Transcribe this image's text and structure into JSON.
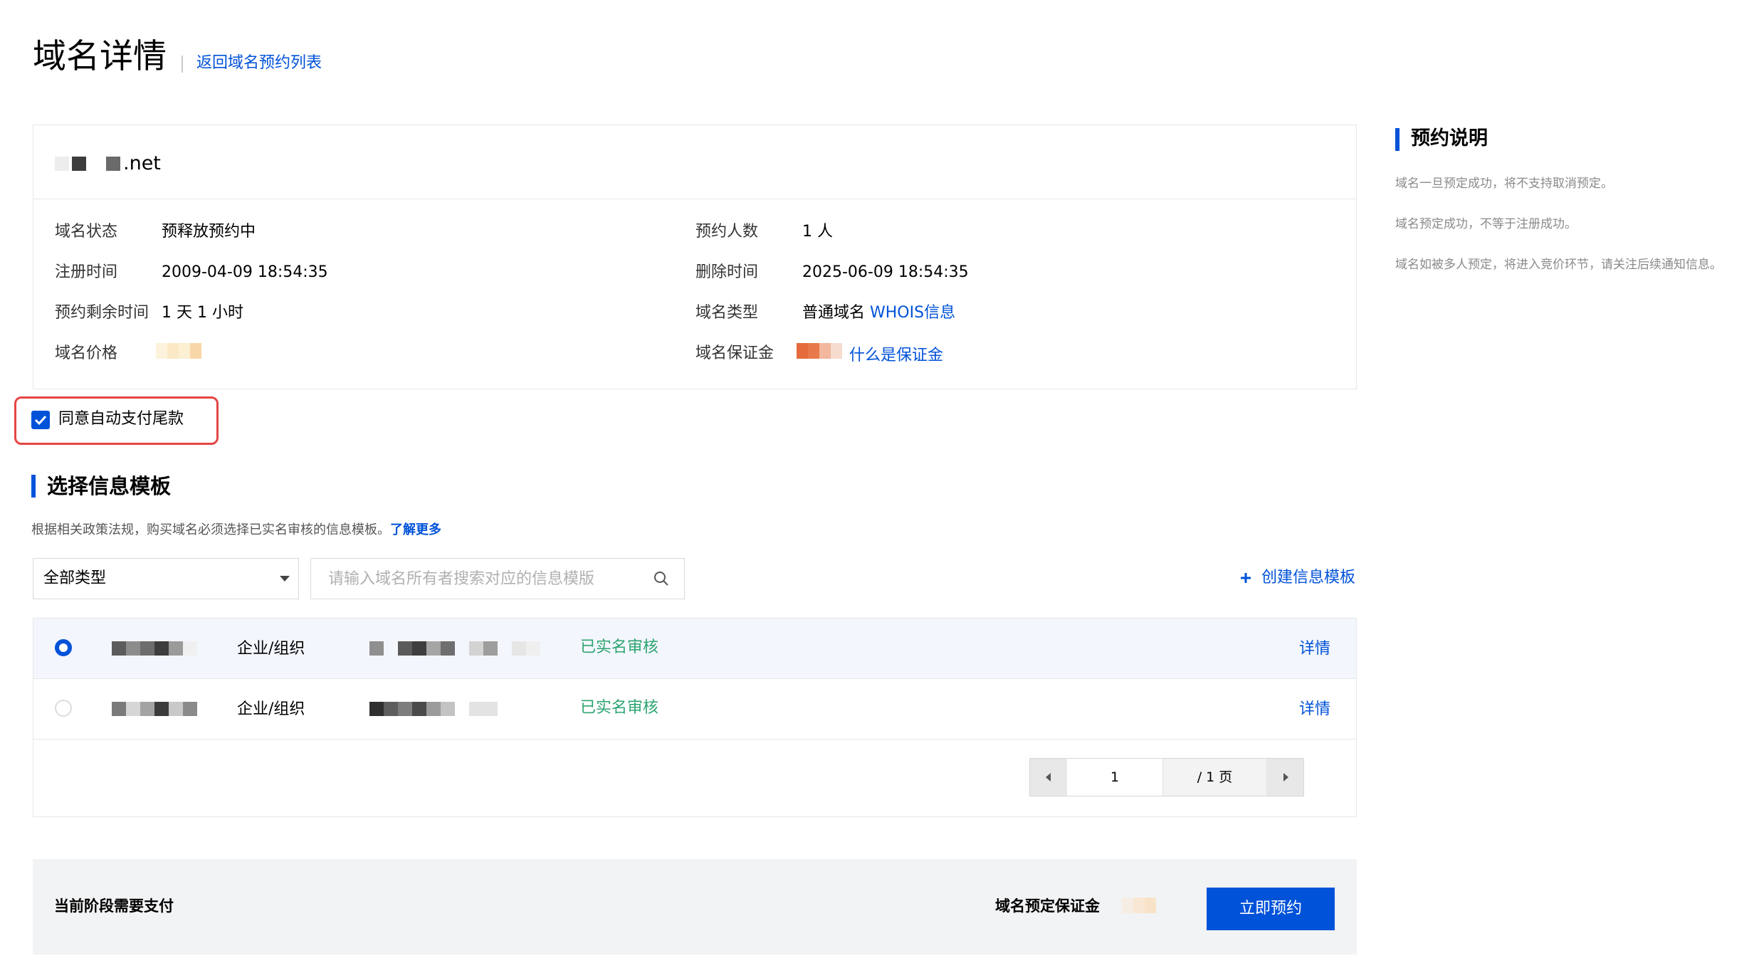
{
  "header": {
    "title": "域名详情",
    "back_link": "返回域名预约列表"
  },
  "domain": {
    "suffix": ".net"
  },
  "info": {
    "status_label": "域名状态",
    "status_value": "预释放预约中",
    "reg_time_label": "注册时间",
    "reg_time_value": "2009-04-09 18:54:35",
    "remaining_label": "预约剩余时间",
    "remaining_value": "1 天 1 小时",
    "price_label": "域名价格",
    "count_label": "预约人数",
    "count_value": "1 人",
    "delete_time_label": "删除时间",
    "delete_time_value": "2025-06-09 18:54:35",
    "type_label": "域名类型",
    "type_value": "普通域名",
    "whois_link": "WHOIS信息",
    "deposit_label": "域名保证金",
    "deposit_link": "什么是保证金"
  },
  "auto_pay": {
    "label": "同意自动支付尾款",
    "checked": true
  },
  "template_section": {
    "title": "选择信息模板",
    "desc": "根据相关政策法规，购买域名必须选择已实名审核的信息模板。",
    "learn_more": "了解更多",
    "filter_value": "全部类型",
    "search_placeholder": "请输入域名所有者搜索对应的信息模版",
    "create_link": "创建信息模板"
  },
  "templates": [
    {
      "type": "企业/组织",
      "status": "已实名审核",
      "action": "详情",
      "selected": true
    },
    {
      "type": "企业/组织",
      "status": "已实名审核",
      "action": "详情",
      "selected": false
    }
  ],
  "pagination": {
    "current": "1",
    "total": "/ 1 页"
  },
  "payment": {
    "stage_label": "当前阶段需要支付",
    "deposit_label": "域名预定保证金",
    "reserve_button": "立即预约"
  },
  "side_panel": {
    "title": "预约说明",
    "notes": [
      "域名一旦预定成功，将不支持取消预定。",
      "域名预定成功，不等于注册成功。",
      "域名如被多人预定，将进入竞价环节，请关注后续通知信息。"
    ]
  },
  "colors": {
    "accent": "#0052d9",
    "success": "#2ba471",
    "highlight": "#e54545"
  }
}
